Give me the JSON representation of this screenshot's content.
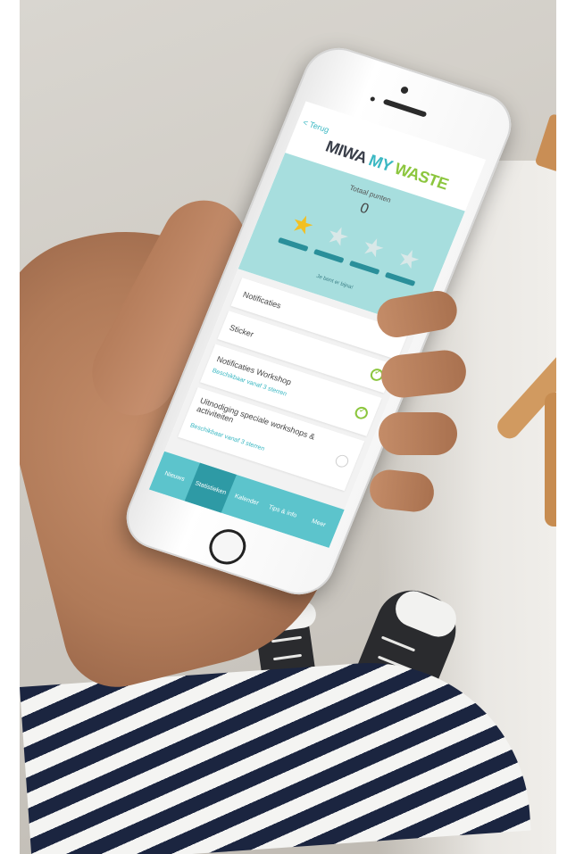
{
  "app": {
    "back_label": "< Terug",
    "logo": {
      "part1": "MIWA",
      "part2": "MY",
      "part3": "WASTE"
    },
    "colors": {
      "teal": "#3bb8c3",
      "green": "#8cc63e",
      "dark": "#3a3f4a",
      "stats_bg": "#a7dede",
      "tab_bar": "#5cc4cc"
    }
  },
  "stats": {
    "total_label": "Totaal punten",
    "total_value": "0",
    "stars_filled": 1,
    "stars_total": 4,
    "goal_text": "Je bent er bijna!"
  },
  "list": {
    "items": [
      {
        "title": "Notificaties",
        "sub": "",
        "checked": null
      },
      {
        "title": "Sticker",
        "sub": "",
        "checked": true
      },
      {
        "title": "Notificaties Workshop",
        "sub": "Beschikbaar vanaf 3 sterren",
        "checked": true
      },
      {
        "title": "Uitnodiging speciale workshops & activiteiten",
        "sub": "Beschikbaar vanaf 3 sterren",
        "checked": false
      }
    ]
  },
  "tabs": [
    {
      "label": "Nieuws",
      "active": false
    },
    {
      "label": "Statistieken",
      "active": true
    },
    {
      "label": "Kalender",
      "active": false
    },
    {
      "label": "Tips & info",
      "active": false
    },
    {
      "label": "Meer",
      "active": false
    }
  ]
}
